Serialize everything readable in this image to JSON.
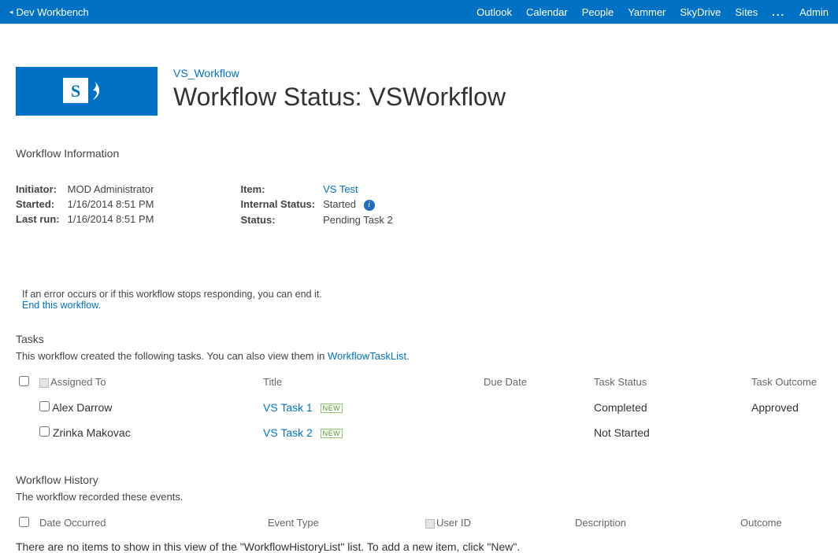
{
  "topbar": {
    "site_name": "Dev Workbench",
    "links": [
      "Outlook",
      "Calendar",
      "People",
      "Yammer",
      "SkyDrive",
      "Sites"
    ],
    "more": "...",
    "admin": "Admin"
  },
  "header": {
    "breadcrumb": "VS_Workflow",
    "title": "Workflow Status: VSWorkflow"
  },
  "workflow_info": {
    "heading": "Workflow Information",
    "left": {
      "initiator_label": "Initiator:",
      "initiator": "MOD Administrator",
      "started_label": "Started:",
      "started": "1/16/2014 8:51 PM",
      "lastrun_label": "Last run:",
      "lastrun": "1/16/2014 8:51 PM"
    },
    "right": {
      "item_label": "Item:",
      "item": "VS Test",
      "internal_status_label": "Internal Status:",
      "internal_status": "Started",
      "status_label": "Status:",
      "status": "Pending Task 2"
    }
  },
  "hint": {
    "text": "If an error occurs or if this workflow stops responding, you can end it.",
    "link": "End this workflow."
  },
  "tasks": {
    "heading": "Tasks",
    "sub_pre": "This workflow created the following tasks. You can also view them in ",
    "sub_link": "WorkflowTaskList",
    "cols": {
      "assigned": "Assigned To",
      "title": "Title",
      "due": "Due Date",
      "status": "Task Status",
      "outcome": "Task Outcome"
    },
    "rows": [
      {
        "assigned": "Alex Darrow",
        "title": "VS Task 1",
        "new_badge": "NEW",
        "due": "",
        "status": "Completed",
        "outcome": "Approved"
      },
      {
        "assigned": "Zrinka Makovac",
        "title": "VS Task 2",
        "new_badge": "NEW",
        "due": "",
        "status": "Not Started",
        "outcome": ""
      }
    ]
  },
  "history": {
    "heading": "Workflow History",
    "sub": "The workflow recorded these events.",
    "cols": {
      "date": "Date Occurred",
      "event": "Event Type",
      "user": "User ID",
      "desc": "Description",
      "outcome": "Outcome"
    },
    "empty": "There are no items to show in this view of the \"WorkflowHistoryList\" list. To add a new item, click \"New\"."
  }
}
